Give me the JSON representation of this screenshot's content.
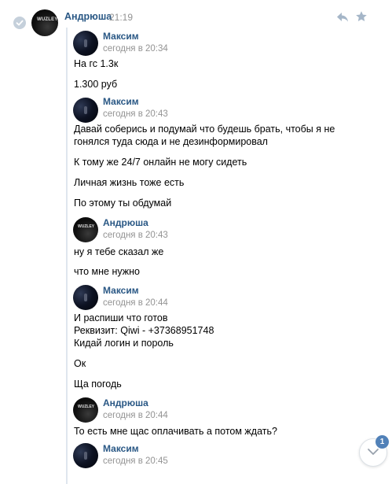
{
  "root": {
    "author": "Андрюша",
    "time": "21:19",
    "avatar_tag": "WUZLEY"
  },
  "forwarded": [
    {
      "author": "Максим",
      "time": "сегодня в 20:34",
      "lines": [
        "На гс 1.3к",
        "1.300 руб"
      ]
    },
    {
      "author": "Максим",
      "time": "сегодня в 20:43",
      "lines": [
        "Давай соберись и подумай что будешь брать, чтобы я не",
        "гонялся туда сюда и не дезинформировал",
        "К тому же 24/7 онлайн не могу сидеть",
        "Личная жизнь тоже есть",
        "По этому ты обдумай"
      ]
    },
    {
      "author": "Андрюша",
      "time": "сегодня в 20:43",
      "lines": [
        "ну я тебе сказал же",
        "что мне нужно"
      ]
    },
    {
      "author": "Максим",
      "time": "сегодня в 20:44",
      "lines": [
        "И распиши что готов",
        "Реквизит: Qiwi - +37368951748",
        "Кидай логин и пороль",
        "Ок",
        "Ща погодь"
      ]
    },
    {
      "author": "Андрюша",
      "time": "сегодня в 20:44",
      "lines": [
        "То есть мне щас оплачивать а потом ждать?"
      ]
    },
    {
      "author": "Максим",
      "time": "сегодня в 20:45",
      "lines": []
    }
  ],
  "scroll": {
    "badge": "1"
  },
  "colors": {
    "link": "#2a5885",
    "muted": "#939393",
    "badge": "#5181b8"
  },
  "icons": [
    "check-icon",
    "reply-icon",
    "star-icon",
    "chevron-down-icon"
  ]
}
